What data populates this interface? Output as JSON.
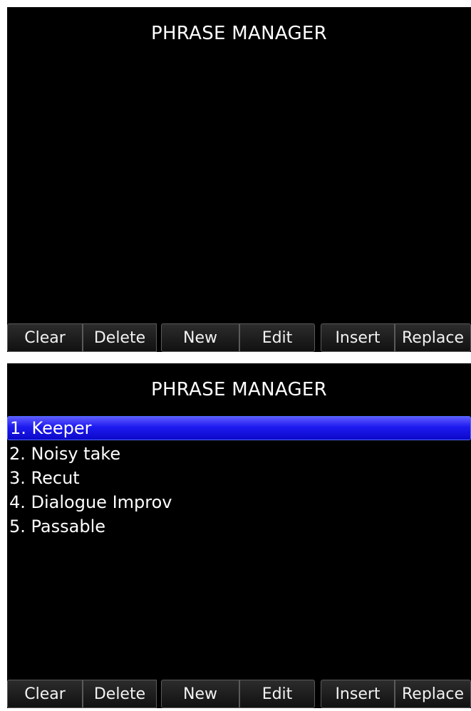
{
  "screens": [
    {
      "title": "PHRASE MANAGER",
      "items": [],
      "softkeys": [
        "Clear",
        "Delete",
        "New",
        "Edit",
        "Insert",
        "Replace"
      ]
    },
    {
      "title": "PHRASE MANAGER",
      "items": [
        {
          "label": "1. Keeper",
          "selected": true
        },
        {
          "label": "2. Noisy take",
          "selected": false
        },
        {
          "label": "3. Recut",
          "selected": false
        },
        {
          "label": "4. Dialogue Improv",
          "selected": false
        },
        {
          "label": "5. Passable",
          "selected": false
        }
      ],
      "softkeys": [
        "Clear",
        "Delete",
        "New",
        "Edit",
        "Insert",
        "Replace"
      ]
    }
  ],
  "colors": {
    "background": "#000000",
    "text": "#ffffff",
    "selection": "#1d1af0"
  }
}
